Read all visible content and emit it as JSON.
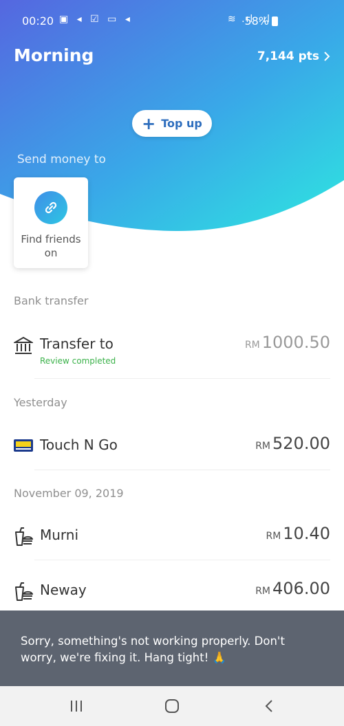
{
  "status_bar": {
    "time": "00:20",
    "left_icons": "▣ ◂ ☑ ▭ ◂",
    "right_icons": "≋ .ıl .ıl",
    "battery": "58%"
  },
  "header": {
    "greeting": "Morning",
    "points": "7,144 pts",
    "gradient_start": "#4a7de2",
    "gradient_end": "#2ee0e0"
  },
  "topup": {
    "label": "Top up"
  },
  "send_money": {
    "label": "Send money to",
    "find_friends_label": "Find friends on"
  },
  "sections": {
    "bank_transfer": "Bank transfer",
    "yesterday": "Yesterday",
    "nov": "November 09, 2019"
  },
  "transactions": [
    {
      "name": "Transfer to",
      "sub": "Review completed",
      "currency": "RM",
      "amount": "1000.50",
      "icon": "bank-icon"
    },
    {
      "name": "Touch N Go",
      "currency": "RM",
      "amount": "520.00",
      "icon": "touch-n-go-logo"
    },
    {
      "name": "Murni",
      "currency": "RM",
      "amount": "10.40",
      "icon": "food-icon"
    },
    {
      "name": "Neway",
      "currency": "RM",
      "amount": "406.00",
      "icon": "food-icon"
    }
  ],
  "error": {
    "message": "Sorry, something's not working properly. Don't worry, we're fixing it. Hang tight! 🙏"
  },
  "nav": {
    "recent": "|||",
    "home": "◯",
    "back": "‹"
  }
}
